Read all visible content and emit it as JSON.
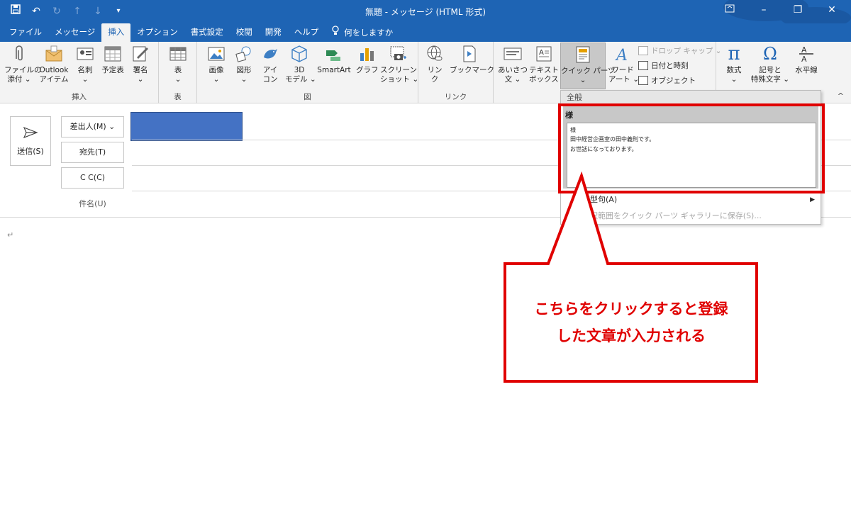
{
  "window": {
    "title": "無題  -  メッセージ (HTML 形式)",
    "qat": {
      "save": "save-icon",
      "undo": "undo-icon",
      "redo": "redo-icon",
      "up": "up-icon",
      "down": "down-icon",
      "more": "customize-icon"
    },
    "controls": {
      "display": "ribbon-display-icon",
      "minimize": "–",
      "restore": "❐",
      "close": "✕"
    }
  },
  "tabs": [
    "ファイル",
    "メッセージ",
    "挿入",
    "オプション",
    "書式設定",
    "校閲",
    "開発",
    "ヘルプ"
  ],
  "active_tab": "挿入",
  "tell_me": "何をしますか",
  "ribbon": {
    "insert_group": {
      "label": "挿入",
      "attach": [
        "ファイルの",
        "添付 ⌄"
      ],
      "outlook_item": [
        "Outlook",
        "アイテム"
      ],
      "business_card": [
        "名刺",
        "⌄"
      ],
      "calendar": [
        "予定表",
        ""
      ],
      "signature": [
        "署名",
        "⌄"
      ]
    },
    "table_group": {
      "label": "表",
      "table": [
        "表",
        "⌄"
      ]
    },
    "illust_group": {
      "label": "図",
      "picture": [
        "画像",
        "⌄"
      ],
      "shapes": [
        "図形",
        "⌄"
      ],
      "icons": [
        "アイ",
        "コン"
      ],
      "models3d": [
        "3D",
        "モデル ⌄"
      ],
      "smartart": [
        "SmartArt",
        ""
      ],
      "chart": [
        "グラフ",
        ""
      ],
      "screenshot": [
        "スクリーン",
        "ショット ⌄"
      ]
    },
    "link_group": {
      "label": "リンク",
      "link": [
        "リン",
        "ク"
      ],
      "bookmark": [
        "ブックマーク",
        ""
      ]
    },
    "text_group": {
      "greeting": [
        "あいさつ",
        "文 ⌄"
      ],
      "textbox": [
        "テキスト",
        "ボックス ⌄"
      ],
      "quickparts": [
        "クイック パーツ",
        "⌄"
      ],
      "wordart": [
        "ワード",
        "アート ⌄"
      ],
      "dropcap": "ドロップ キャップ ⌄",
      "datetime": "日付と時刻",
      "object": "オブジェクト",
      "greeting_icon_text": "あいさつ"
    },
    "symbol_group": {
      "equation": [
        "数式",
        "⌄"
      ],
      "symbol": [
        "記号と",
        "特殊文字 ⌄"
      ],
      "hline": [
        "水平線",
        ""
      ]
    }
  },
  "compose": {
    "send": "送信(S)",
    "from": "差出人(M) ⌄",
    "to": "宛先(T)",
    "cc": "C C(C)",
    "subject": "件名(U)",
    "body_mark": "↵"
  },
  "quickparts_menu": {
    "header": "全般",
    "entry_name": "様",
    "entry_lines": [
      "様",
      "田中経営企画室の田中義則です。",
      "お世話になっております。"
    ],
    "item1": "定型句(A)",
    "item2": "選択範囲をクイック パーツ ギャラリーに保存(S)..."
  },
  "annotation": {
    "lines": [
      "こちらをクリックすると登録",
      "した文章が入力される"
    ]
  },
  "colors": {
    "titlebar": "#1e64b4",
    "annotation": "#e00000",
    "redacted": "#4472c4"
  }
}
